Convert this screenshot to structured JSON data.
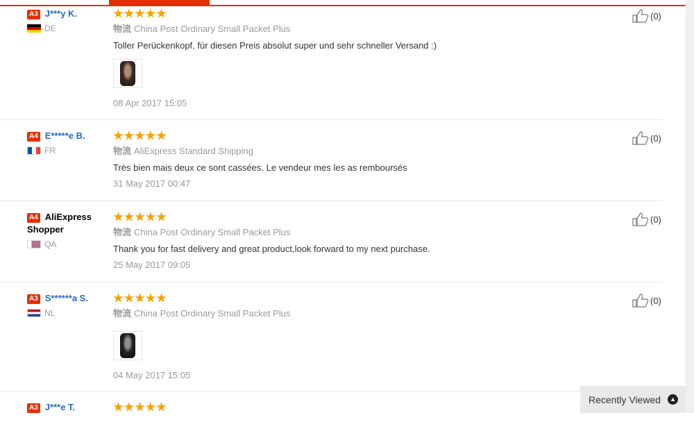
{
  "reviews": [
    {
      "level": "A3",
      "name": "J***y K.",
      "country": "DE",
      "flag": "de",
      "stars": 5,
      "logistics_label": "物流",
      "shipping": "China Post Ordinary Small Packet Plus",
      "text": "Toller Perückenkopf, für diesen Preis absolut super und sehr schneller Versand :)",
      "has_photo": true,
      "date": "08 Apr 2017 15:05",
      "helpful": "(0)"
    },
    {
      "level": "A4",
      "name": "E*****e B.",
      "country": "FR",
      "flag": "fr",
      "stars": 5,
      "logistics_label": "物流",
      "shipping": "AliExpress Standard Shipping",
      "text": "Très bien mais deux ce sont cassées. Le vendeur mes les as remboursés",
      "has_photo": false,
      "date": "31 May 2017 00:47",
      "helpful": "(0)"
    },
    {
      "level": "A4",
      "name": "AliExpress Shopper",
      "country": "QA",
      "flag": "qa",
      "stars": 5,
      "logistics_label": "物流",
      "shipping": "China Post Ordinary Small Packet Plus",
      "text": "Thank you for fast delivery and great product,look forward to my next purchase.",
      "has_photo": false,
      "date": "25 May 2017 09:05",
      "helpful": "(0)"
    },
    {
      "level": "A3",
      "name": "S******a S.",
      "country": "NL",
      "flag": "nl",
      "stars": 5,
      "logistics_label": "物流",
      "shipping": "China Post Ordinary Small Packet Plus",
      "text": "",
      "has_photo": true,
      "date": "04 May 2017 15:05",
      "helpful": "(0)"
    },
    {
      "level": "A3",
      "name": "J***e T.",
      "stars": 5
    }
  ],
  "recently_viewed": {
    "label": "Recently Viewed",
    "icon": "chevron-up-circle-icon"
  },
  "colors": {
    "accent": "#e62e04",
    "star": "#f7a100",
    "buyer_link": "#2768c0"
  }
}
